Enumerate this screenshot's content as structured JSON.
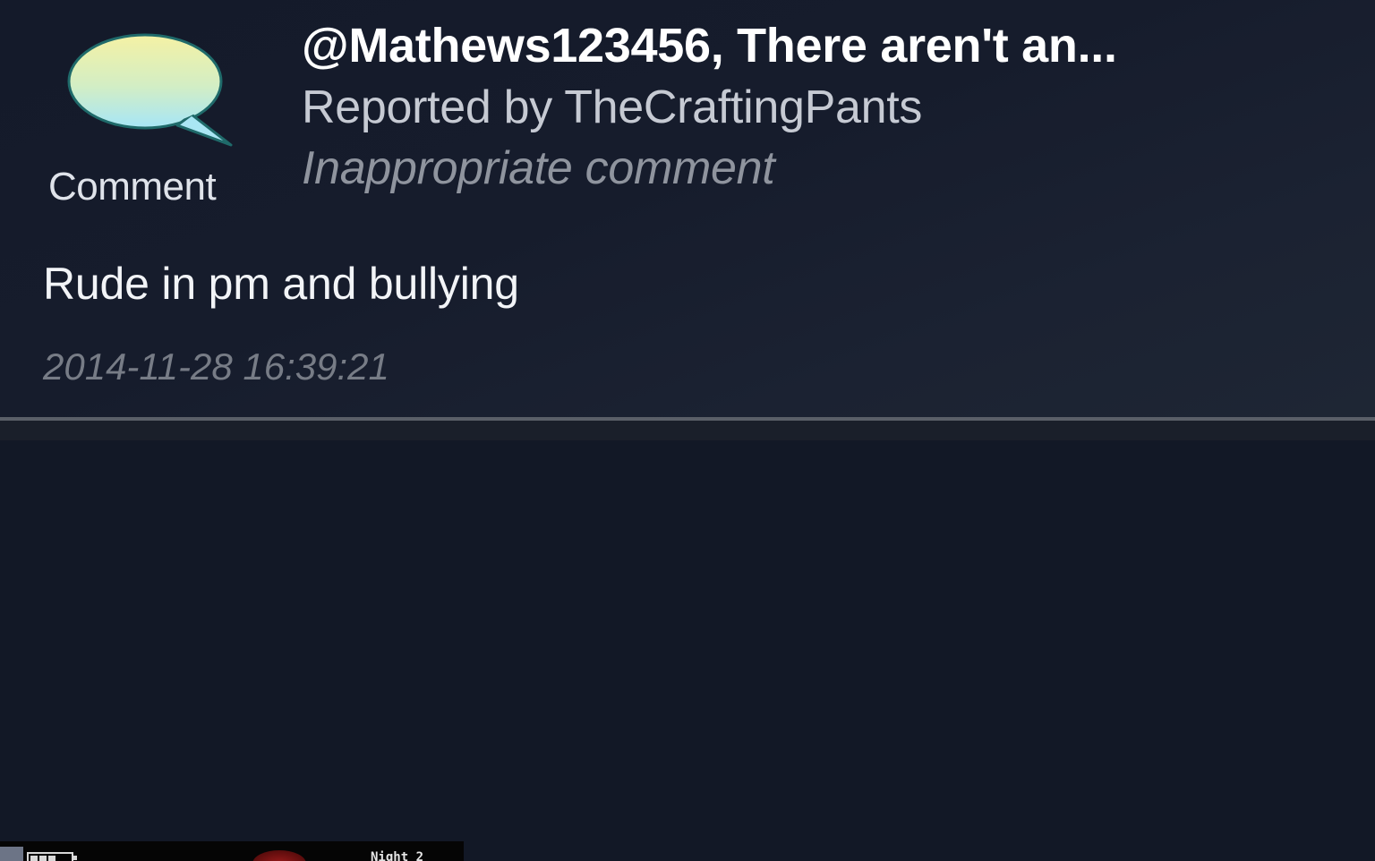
{
  "report": {
    "type_label": "Comment",
    "type_icon": "speech-bubble-icon",
    "title": "@Mathews123456, There aren't an...",
    "reporter": "Reported by TheCraftingPants",
    "reason": "Inappropriate comment",
    "message": "Rude in pm and bullying",
    "timestamp": "2014-11-28 16:39:21"
  },
  "thumbnail_strip": {
    "caption": "Night 2"
  },
  "colors": {
    "background": "#141a2a",
    "title": "#ffffff",
    "reporter": "#c6cad3",
    "reason": "#8f949e",
    "timestamp": "#777c86",
    "bubble_top": "#f3f1a6",
    "bubble_bottom": "#a9e6f4"
  }
}
